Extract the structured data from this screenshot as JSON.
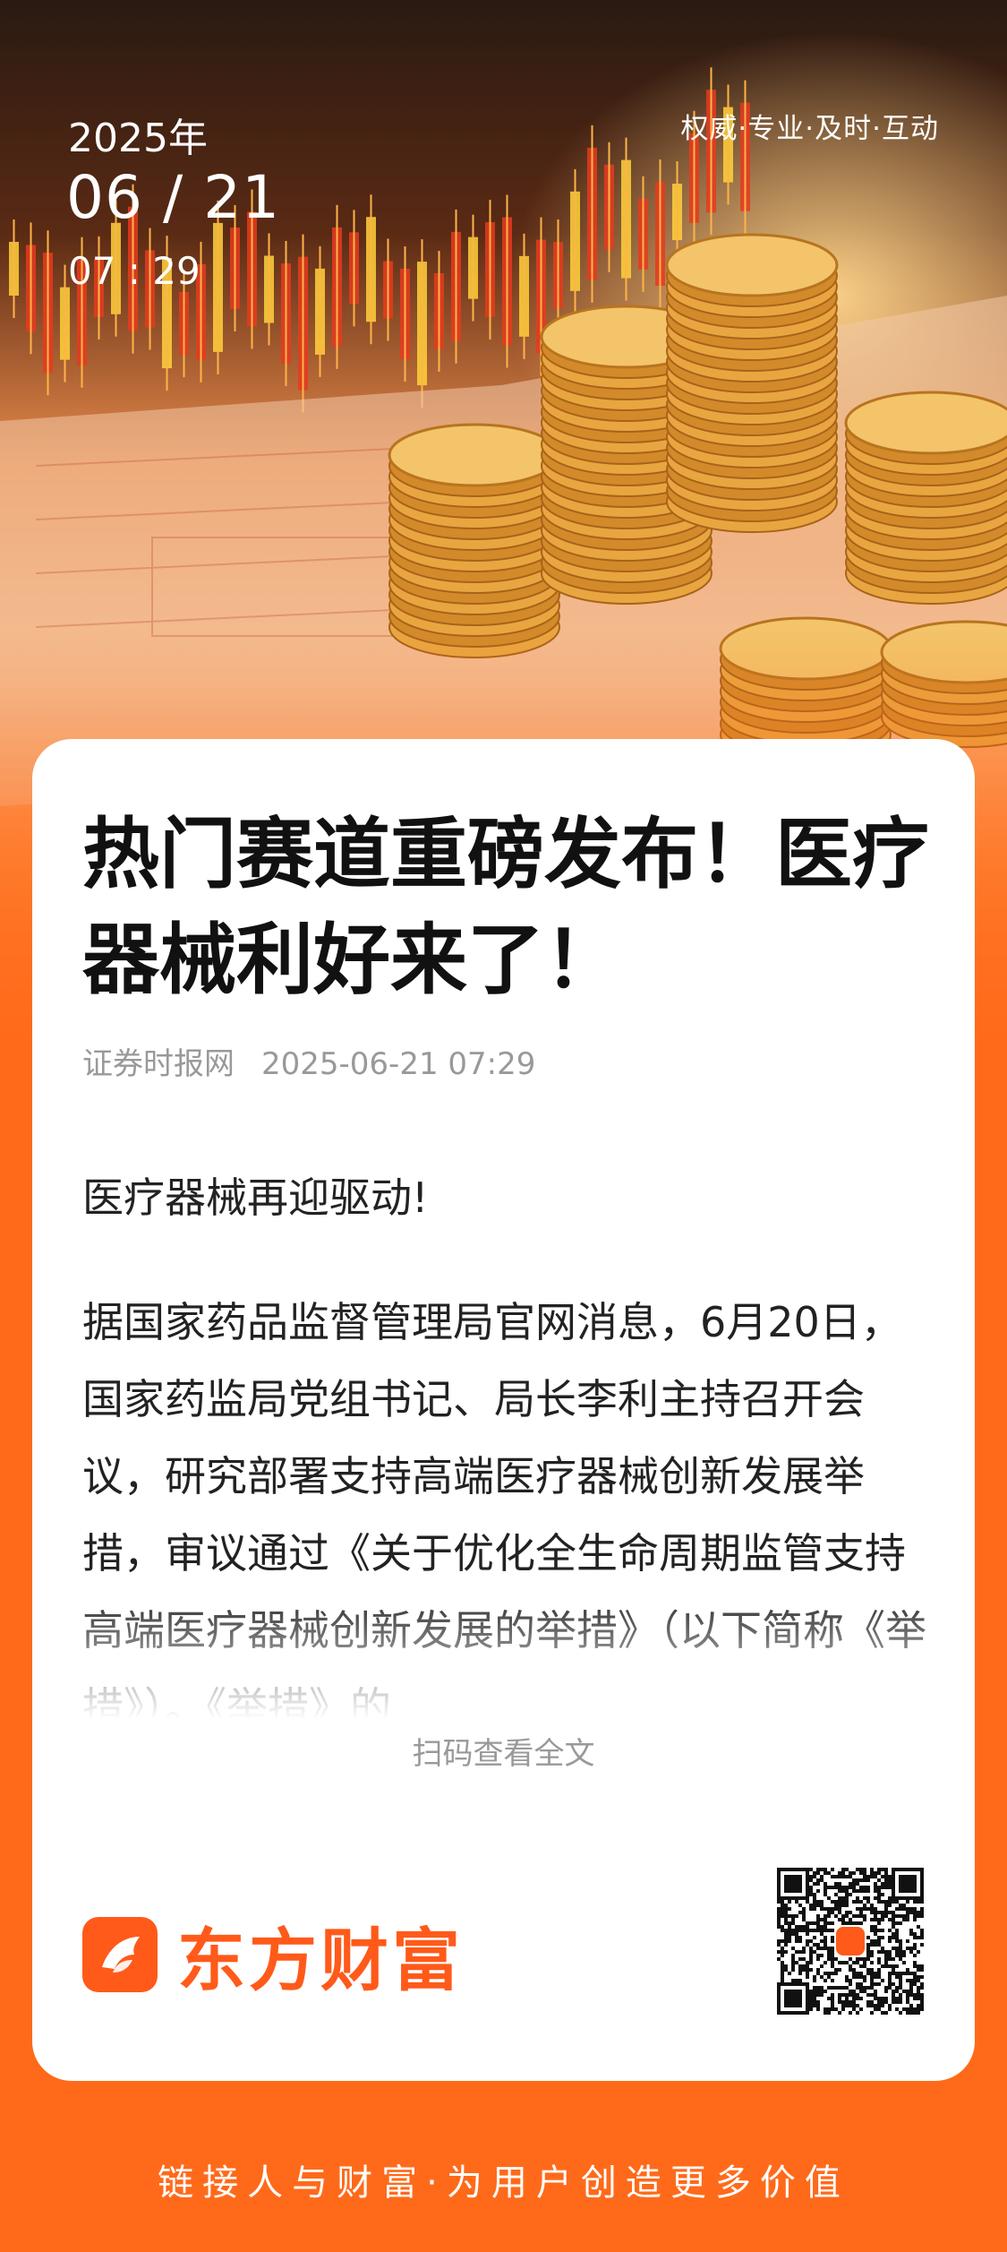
{
  "header": {
    "year": "2025年",
    "date": "06 / 21",
    "time": "07 : 29",
    "slogan": "权威·专业·及时·互动"
  },
  "article": {
    "title": "热门赛道重磅发布！医疗器械利好来了！",
    "source": "证券时报网",
    "datetime": "2025-06-21 07:29",
    "lead": "医疗器械再迎驱动!",
    "body": "据国家药品监督管理局官网消息，6月20日，国家药监局党组书记、局长李利主持召开会议，研究部署支持高端医疗器械创新发展举措，审议通过《关于优化全生命周期监管支持高端医疗器械创新发展的举措》（以下简称《举措》）。《举措》的",
    "read_more": "扫码查看全文"
  },
  "brand": {
    "name": "东方财富",
    "logo_icon": "eastmoney-logo-icon",
    "qr_icon": "qr-code-icon"
  },
  "footer": {
    "slogan": "链接人与财富·为用户创造更多价值"
  },
  "colors": {
    "brand_orange": "#ff5a1a",
    "background": "#ff6a1a",
    "card": "#ffffff",
    "meta_gray": "#999999"
  }
}
